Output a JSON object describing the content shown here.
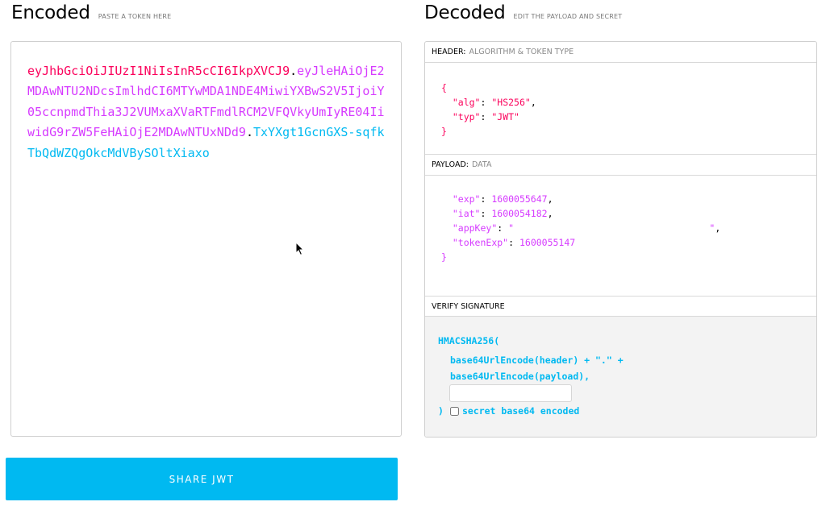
{
  "encoded": {
    "title": "Encoded",
    "subtitle": "PASTE A TOKEN HERE",
    "token": {
      "header": "eyJhbGciOiJIUzI1NiIsInR5cCI6IkpXVCJ9",
      "payload": "eyJleHAiOjE2MDAwNTU2NDcsImlhdCI6MTYwMDA1NDE4MiwiYXBwS2V5IjoiY05ccnpmdThia3J2VUMxaXVaRTFmdlRCM2VFQVkyUmIyRE04IiwidG9rZW5FeHAiOjE2MDAwNTUxNDd9",
      "signature": "TxYXgt1GcnGXS-sqfkTbQdWZQgOkcMdVBySOltXiaxo",
      "dot": "."
    }
  },
  "share_button": "SHARE JWT",
  "decoded": {
    "title": "Decoded",
    "subtitle": "EDIT THE PAYLOAD AND SECRET",
    "header_section": {
      "label": "HEADER:",
      "desc": "ALGORITHM & TOKEN TYPE"
    },
    "header_json": {
      "open": "{",
      "alg_key": "\"alg\"",
      "alg_val": "\"HS256\"",
      "typ_key": "\"typ\"",
      "typ_val": "\"JWT\"",
      "close": "}"
    },
    "payload_section": {
      "label": "PAYLOAD:",
      "desc": "DATA"
    },
    "payload_json": {
      "exp_key": "\"exp\"",
      "exp_val": "1600055647",
      "iat_key": "\"iat\"",
      "iat_val": "1600054182",
      "appkey_key": "\"appKey\"",
      "appkey_open": "\"",
      "appkey_close": "\"",
      "tokenexp_key": "\"tokenExp\"",
      "tokenexp_val": "1600055147",
      "close": "}"
    },
    "verify_section": {
      "label": "VERIFY SIGNATURE"
    },
    "verify": {
      "fn_open": "HMACSHA256(",
      "line1": "base64UrlEncode(header) + \".\" +",
      "line2": "base64UrlEncode(payload),",
      "close_paren": ")",
      "checkbox_label": "secret base64 encoded"
    }
  },
  "colors": {
    "header": "#fb015b",
    "payload": "#d63aff",
    "signature": "#00b9f1",
    "button": "#00b9f1"
  }
}
